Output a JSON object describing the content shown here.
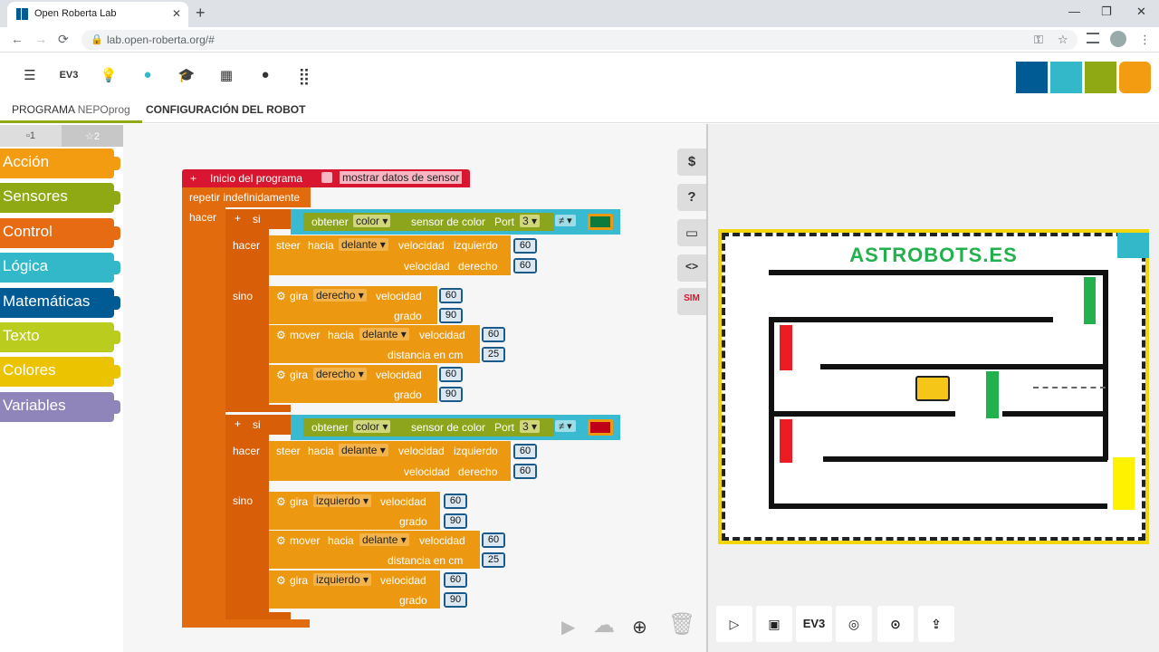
{
  "browser": {
    "tab_title": "Open Roberta Lab",
    "url": "lab.open-roberta.org/#",
    "new_tab": "+",
    "minimize": "—",
    "maximize": "❐",
    "close": "✕",
    "back": "←",
    "forward": "→",
    "reload": "⟳",
    "lock": "🔒",
    "key": "⚿",
    "star": "☆",
    "menu": "⋮"
  },
  "menu": {
    "icons": [
      "☰",
      "EV3",
      "💡",
      "●",
      "🎓",
      "▦",
      "●",
      "⣿"
    ]
  },
  "tabs": {
    "program_prefix": "PROGRAMA",
    "program_name": "NEPOprog",
    "robot_config": "CONFIGURACIÓN DEL ROBOT"
  },
  "levels": {
    "l1": "▫1",
    "l2": "☆2"
  },
  "categories": [
    {
      "label": "Acción",
      "color": "#f39c12"
    },
    {
      "label": "Sensores",
      "color": "#8fa915"
    },
    {
      "label": "Control",
      "color": "#e66b12"
    },
    {
      "label": "Lógica",
      "color": "#33b8ca"
    },
    {
      "label": "Matemáticas",
      "color": "#005a94"
    },
    {
      "label": "Texto",
      "color": "#bacc1e"
    },
    {
      "label": "Colores",
      "color": "#ebc300"
    },
    {
      "label": "Variables",
      "color": "#9085ba"
    }
  ],
  "sidebtns": {
    "s1": "$",
    "s2": "?",
    "s3": "▭",
    "s4": "<>",
    "s5": "SIM"
  },
  "program": {
    "start": "Inicio del programa",
    "show_sensor": "mostrar datos de sensor",
    "forever": "repetir indefinidamente",
    "hacer": "hacer",
    "si": "si",
    "sino": "sino",
    "plus": "+",
    "obtener": "obtener",
    "color": "color",
    "sensor_color": "sensor de color",
    "port": "Port",
    "port_num": "3",
    "neq": "≠",
    "steer": "steer",
    "hacia": "hacia",
    "delante": "delante",
    "velocidad": "velocidad",
    "izquierdo": "izquierdo",
    "derecho": "derecho",
    "gira": "gira",
    "grado": "grado",
    "mover": "mover",
    "distancia": "distancia en cm",
    "v60": "60",
    "v90": "90",
    "v25": "25"
  },
  "board": {
    "title": "ASTROBOTS.ES"
  },
  "simbar": {
    "play": "▷",
    "image": "▣",
    "ev3": "EV3",
    "sound": "◎",
    "pin": "⊙",
    "home": "⇪"
  },
  "bottom": {
    "play": "▶",
    "cloud": "☁",
    "zoom": "⊕",
    "trash": "🗑"
  }
}
